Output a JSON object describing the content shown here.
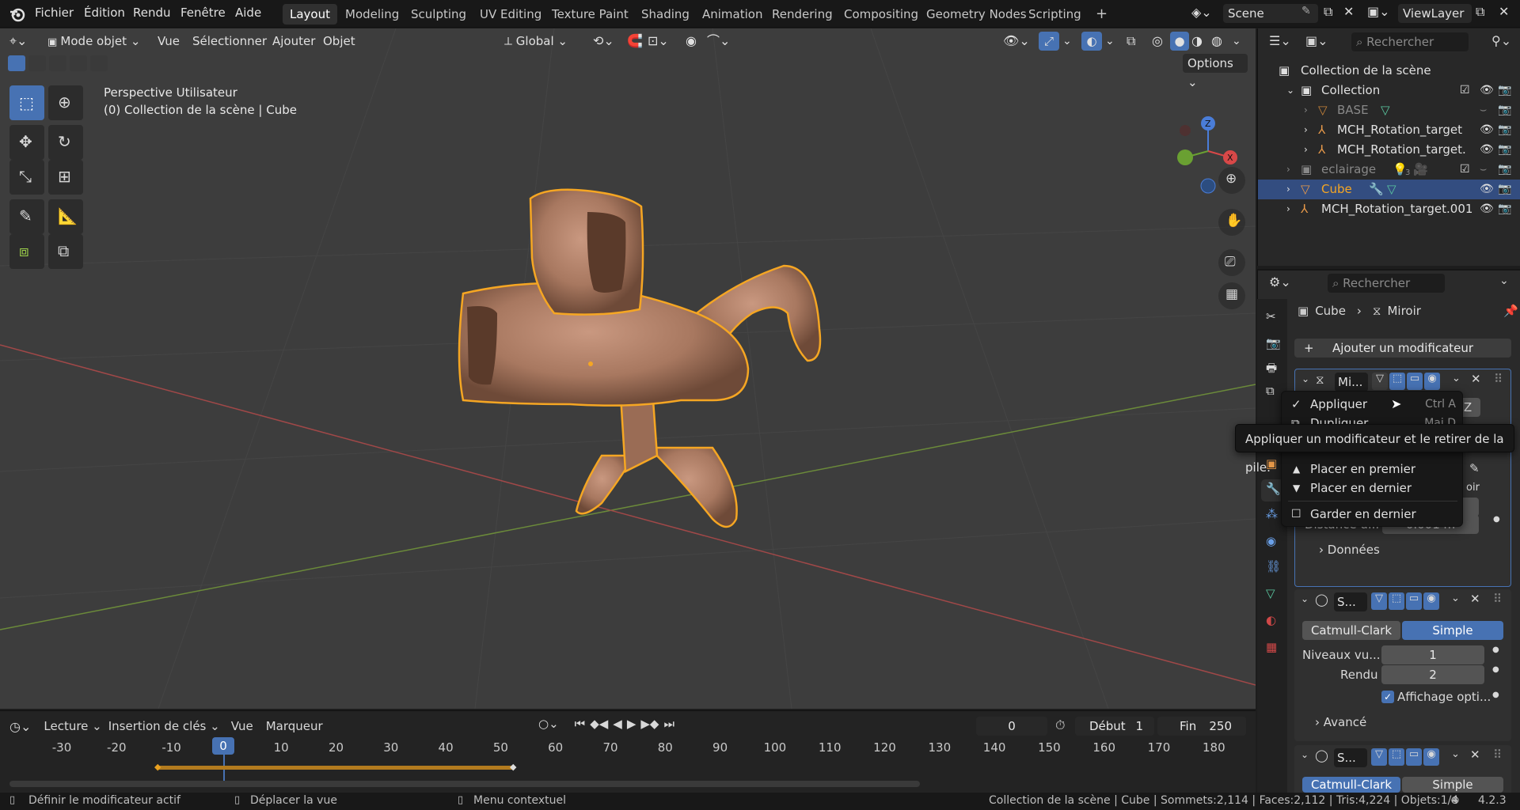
{
  "menubar": {
    "items": [
      "Fichier",
      "Édition",
      "Rendu",
      "Fenêtre",
      "Aide"
    ],
    "workspaces": [
      "Layout",
      "Modeling",
      "Sculpting",
      "UV Editing",
      "Texture Paint",
      "Shading",
      "Animation",
      "Rendering",
      "Compositing",
      "Geometry Nodes",
      "Scripting"
    ],
    "active_workspace": "Layout",
    "scene": "Scene",
    "view_layer": "ViewLayer",
    "add_workspace": "+"
  },
  "viewport_header": {
    "mode": "Mode objet",
    "menus": [
      "Vue",
      "Sélectionner",
      "Ajouter",
      "Objet"
    ],
    "transform_orientation": "Global",
    "options": "Options"
  },
  "viewport": {
    "view_name": "Perspective Utilisateur",
    "collection_info": "(0) Collection de la scène | Cube",
    "axis_labels": {
      "z": "Z",
      "x": "X"
    }
  },
  "timeline": {
    "menus": [
      "Lecture",
      "Insertion de clés",
      "Vue",
      "Marqueur"
    ],
    "current_frame": "0",
    "start_label": "Début",
    "start": "1",
    "end_label": "Fin",
    "end": "250",
    "ticks": [
      "-30",
      "-20",
      "-10",
      "0",
      "10",
      "20",
      "30",
      "40",
      "50",
      "60",
      "70",
      "80",
      "90",
      "100",
      "110",
      "120",
      "130",
      "140",
      "150",
      "160",
      "170",
      "180"
    ],
    "playhead": "0"
  },
  "statusbar": {
    "left": [
      "Définir le modificateur actif",
      "Déplacer la vue",
      "Menu contextuel"
    ],
    "right": "Collection de la scène | Cube | Sommets:2,114 | Faces:2,112 | Tris:4,224 | Objets:1/4",
    "version": "4.2.3"
  },
  "outliner": {
    "search_placeholder": "Rechercher",
    "root": "Collection de la scène",
    "rows": [
      {
        "label": "Collection",
        "icon": "collection-icon"
      },
      {
        "label": "BASE",
        "icon": "mesh-icon",
        "dim": true
      },
      {
        "label": "MCH_Rotation_target",
        "icon": "armature-icon"
      },
      {
        "label": "MCH_Rotation_target.",
        "icon": "armature-icon"
      },
      {
        "label": "eclairage",
        "icon": "collection-icon",
        "dim": true,
        "badge": "3"
      },
      {
        "label": "Cube",
        "icon": "mesh-icon",
        "selected": true
      },
      {
        "label": "MCH_Rotation_target.001",
        "icon": "armature-icon"
      }
    ]
  },
  "properties": {
    "search_placeholder": "Rechercher",
    "breadcrumb": [
      "Cube",
      "Miroir"
    ],
    "add_modifier": "Ajouter un modificateur",
    "mirror": {
      "name": "Mi...",
      "distance_label": "Distance d...",
      "distance_value": "0.001 m",
      "data_label": "Données",
      "bisect_fragment": "oir",
      "axis_fragment": "Z"
    },
    "subsurf1": {
      "name": "S...",
      "catmull": "Catmull-Clark",
      "simple": "Simple",
      "levels_label": "Niveaux vu...",
      "levels_value": "1",
      "render_label": "Rendu",
      "render_value": "2",
      "optimal_label": "Affichage opti...",
      "advanced": "Avancé"
    },
    "subsurf2": {
      "name": "S...",
      "catmull": "Catmull-Clark",
      "simple": "Simple"
    }
  },
  "context_menu": {
    "items": [
      {
        "label": "Appliquer",
        "key": "Ctrl A",
        "icon": "check-icon"
      },
      {
        "label": "Dupliquer",
        "key": "Maj D",
        "icon": "duplicate-icon"
      },
      {
        "label": "Placer en premier",
        "icon": "triangle-up-icon"
      },
      {
        "label": "Placer en dernier",
        "icon": "triangle-down-icon"
      },
      {
        "label": "Garder en dernier",
        "icon": "checkbox-icon"
      }
    ]
  },
  "tooltip": "Appliquer un modificateur et le retirer de la pile.",
  "colors": {
    "accent": "#4772b3",
    "selection_outline": "#f5a623",
    "selected_row": "#334d80"
  }
}
